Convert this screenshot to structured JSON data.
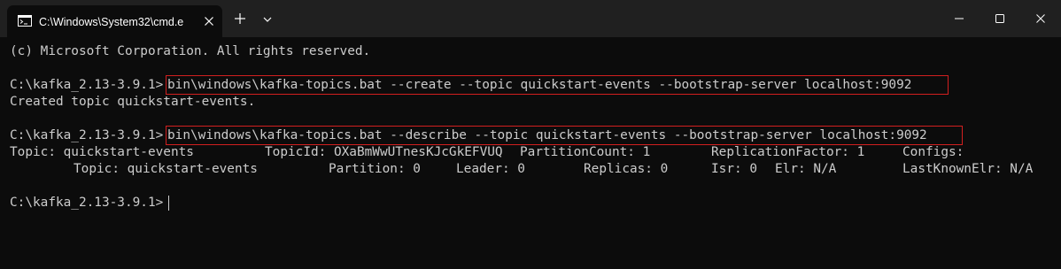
{
  "window": {
    "tab_title": "C:\\Windows\\System32\\cmd.e",
    "tab_icon": "terminal-icon",
    "controls": [
      "close-icon",
      "plus-icon",
      "chevron-down-icon",
      "minimize-icon",
      "maximize-icon",
      "window-close-icon"
    ]
  },
  "colors": {
    "background": "#0c0c0c",
    "titlebar": "#202020",
    "text": "#cccccc",
    "highlight_border": "#d21f1f"
  },
  "terminal": {
    "copyright": "(c) Microsoft Corporation. All rights reserved.",
    "prompt": "C:\\kafka_2.13-3.9.1>",
    "create_command": "bin\\windows\\kafka-topics.bat --create --topic quickstart-events --bootstrap-server localhost:9092",
    "create_output": "Created topic quickstart-events.",
    "describe_command": "bin\\windows\\kafka-topics.bat --describe --topic quickstart-events --bootstrap-server localhost:9092",
    "describe_header": {
      "topic": "Topic: quickstart-events",
      "topic_id": "TopicId: OXaBmWwUTnesKJcGkEFVUQ",
      "partition_count": "PartitionCount: 1",
      "replication_factor": "ReplicationFactor: 1",
      "configs": "Configs:"
    },
    "describe_partition": {
      "topic": "Topic: quickstart-events",
      "partition": "Partition: 0",
      "leader": "Leader: 0",
      "replicas": "Replicas: 0",
      "isr": "Isr: 0",
      "elr": "Elr: N/A",
      "last_known_elr": "LastKnownElr: N/A"
    }
  }
}
